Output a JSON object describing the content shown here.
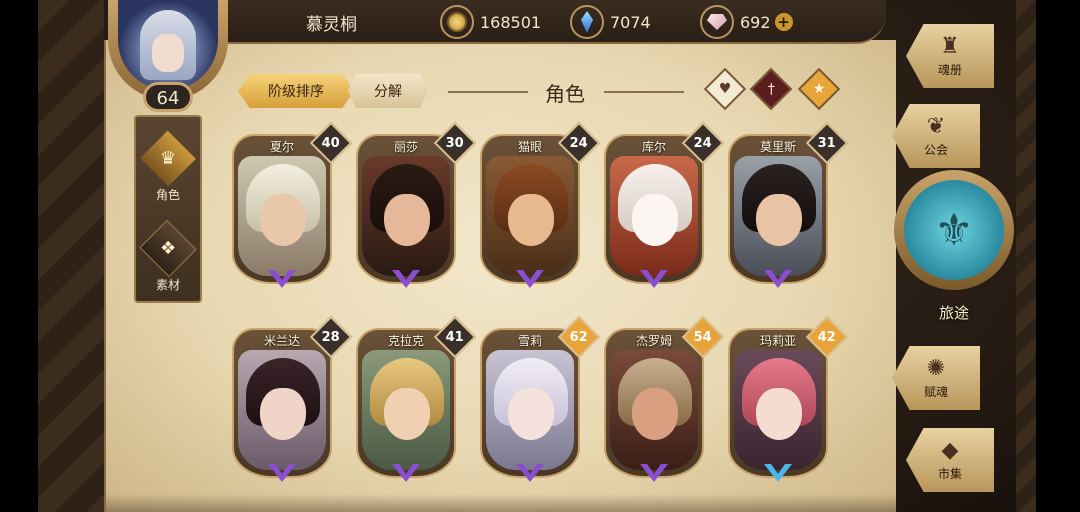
{
  "header": {
    "player_name": "慕灵桐",
    "player_level": "64",
    "currencies": [
      {
        "icon": "gold-coin-icon",
        "value": "168501"
      },
      {
        "icon": "blue-crystal-icon",
        "value": "7074"
      },
      {
        "icon": "pink-gem-icon",
        "value": "692"
      }
    ],
    "add_label": "+"
  },
  "side_menu": {
    "items": [
      {
        "label": "角色",
        "icon": "character-mask-icon"
      },
      {
        "label": "素材",
        "icon": "material-beast-icon"
      }
    ]
  },
  "panel": {
    "title": "角色",
    "filter_buttons": [
      "阶级排序",
      "分解"
    ],
    "icon_buttons": [
      "heart-icon",
      "sword-icon",
      "star-icon"
    ]
  },
  "characters": [
    {
      "name": "夏尔",
      "level": "40"
    },
    {
      "name": "丽莎",
      "level": "30"
    },
    {
      "name": "猫眼",
      "level": "24"
    },
    {
      "name": "库尔",
      "level": "24"
    },
    {
      "name": "莫里斯",
      "level": "31"
    },
    {
      "name": "米兰达",
      "level": "28"
    },
    {
      "name": "克拉克",
      "level": "41"
    },
    {
      "name": "雪莉",
      "level": "62"
    },
    {
      "name": "杰罗姆",
      "level": "54"
    },
    {
      "name": "玛莉亚",
      "level": "42"
    }
  ],
  "right_nav": {
    "items": [
      {
        "label": "魂册",
        "icon": "soul-book-icon"
      },
      {
        "label": "公会",
        "icon": "guild-dragon-icon"
      },
      {
        "label": "旅途",
        "icon": "journey-emblem-icon"
      },
      {
        "label": "赋魂",
        "icon": "soul-flame-icon"
      },
      {
        "label": "市集",
        "icon": "market-crystal-icon"
      }
    ]
  },
  "colors": {
    "parchment": "#ecdcb8",
    "accent_gold": "#c9a36a",
    "rank_purple": "#8a4fd0",
    "rank_gold": "#e8b030"
  }
}
